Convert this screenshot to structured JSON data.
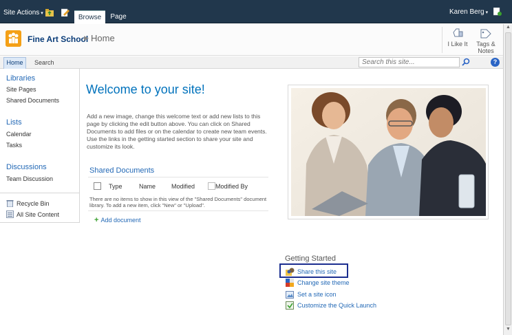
{
  "ribbon": {
    "site_actions": "Site Actions",
    "tabs": [
      "Browse",
      "Page"
    ],
    "user": "Karen Berg"
  },
  "title_area": {
    "site_name": "Fine Art School",
    "breadcrumb": "Home",
    "i_like_it": "I Like It",
    "tags_notes_1": "Tags &",
    "tags_notes_2": "Notes"
  },
  "top_nav": {
    "home": "Home",
    "search": "Search",
    "search_placeholder": "Search this site..."
  },
  "quick_launch": {
    "libraries": "Libraries",
    "site_pages": "Site Pages",
    "shared_documents": "Shared Documents",
    "lists": "Lists",
    "calendar": "Calendar",
    "tasks": "Tasks",
    "discussions": "Discussions",
    "team_discussion": "Team Discussion",
    "recycle_bin": "Recycle Bin",
    "all_site_content": "All Site Content"
  },
  "main": {
    "welcome_title": "Welcome to your site!",
    "welcome_text": "Add a new image, change this welcome text or add new lists to this page by clicking the edit button above. You can click on Shared Documents to add files or on the calendar to create new team events. Use the links in the getting started section to share your site and customize its look.",
    "doc_library_title": "Shared Documents",
    "columns": [
      "Type",
      "Name",
      "Modified",
      "Modified By"
    ],
    "empty_message": "There are no items to show in this view of the \"Shared Documents\" document library. To add a new item, click \"New\" or \"Upload\".",
    "add_document": "Add document"
  },
  "getting_started": {
    "title": "Getting Started",
    "share": "Share this site",
    "theme": "Change site theme",
    "icon": "Set a site icon",
    "launch": "Customize the Quick Launch"
  }
}
